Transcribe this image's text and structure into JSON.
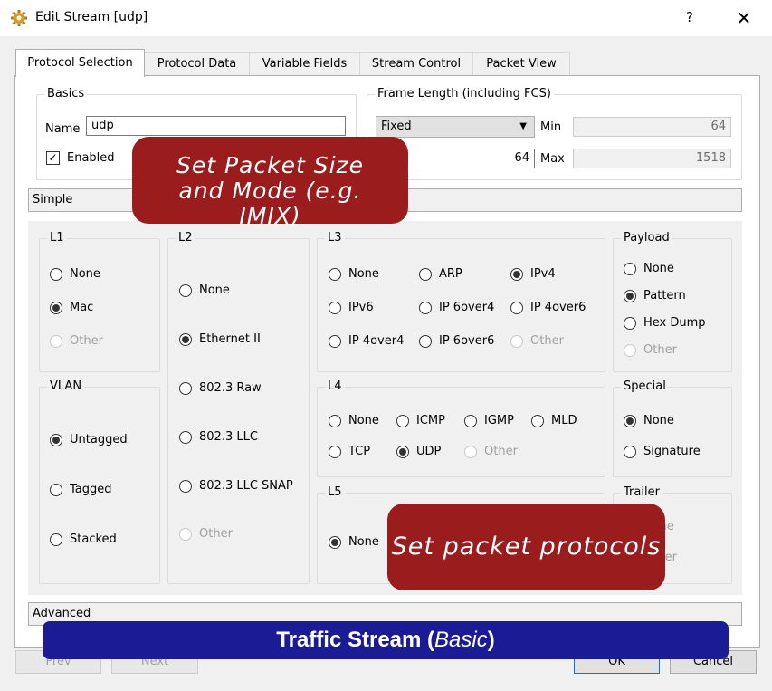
{
  "window": {
    "title": "Edit Stream [udp]",
    "help_label": "?",
    "close_label": "✕",
    "icon": "gear-icon"
  },
  "tabs": [
    {
      "label": "Protocol Selection",
      "active": true
    },
    {
      "label": "Protocol Data",
      "active": false
    },
    {
      "label": "Variable Fields",
      "active": false
    },
    {
      "label": "Stream Control",
      "active": false
    },
    {
      "label": "Packet View",
      "active": false
    }
  ],
  "basics": {
    "title": "Basics",
    "name_label": "Name",
    "name_value": "udp",
    "enabled_label": "Enabled",
    "enabled_checked": true
  },
  "frame_length": {
    "title": "Frame Length (including FCS)",
    "mode": "Fixed",
    "fixed_value": "64",
    "min_label": "Min",
    "min_value": "64",
    "max_label": "Max",
    "max_value": "1518"
  },
  "simple_header": "Simple",
  "advanced_header": "Advanced",
  "groups": {
    "l1": {
      "title": "L1",
      "options": [
        {
          "label": "None",
          "checked": false,
          "disabled": false
        },
        {
          "label": "Mac",
          "checked": true,
          "disabled": false
        },
        {
          "label": "Other",
          "checked": false,
          "disabled": true
        }
      ]
    },
    "vlan": {
      "title": "VLAN",
      "options": [
        {
          "label": "Untagged",
          "checked": true,
          "disabled": false
        },
        {
          "label": "Tagged",
          "checked": false,
          "disabled": false
        },
        {
          "label": "Stacked",
          "checked": false,
          "disabled": false
        }
      ]
    },
    "l2": {
      "title": "L2",
      "options": [
        {
          "label": "None",
          "checked": false,
          "disabled": false
        },
        {
          "label": "Ethernet II",
          "checked": true,
          "disabled": false
        },
        {
          "label": "802.3 Raw",
          "checked": false,
          "disabled": false
        },
        {
          "label": "802.3 LLC",
          "checked": false,
          "disabled": false
        },
        {
          "label": "802.3 LLC SNAP",
          "checked": false,
          "disabled": false
        },
        {
          "label": "Other",
          "checked": false,
          "disabled": true
        }
      ]
    },
    "l3": {
      "title": "L3",
      "options": [
        {
          "label": "None",
          "checked": false,
          "disabled": false
        },
        {
          "label": "ARP",
          "checked": false,
          "disabled": false
        },
        {
          "label": "IPv4",
          "checked": true,
          "disabled": false
        },
        {
          "label": "IPv6",
          "checked": false,
          "disabled": false
        },
        {
          "label": "IP 6over4",
          "checked": false,
          "disabled": false
        },
        {
          "label": "IP 4over6",
          "checked": false,
          "disabled": false
        },
        {
          "label": "IP 4over4",
          "checked": false,
          "disabled": false
        },
        {
          "label": "IP 6over6",
          "checked": false,
          "disabled": false
        },
        {
          "label": "Other",
          "checked": false,
          "disabled": true
        }
      ]
    },
    "l4": {
      "title": "L4",
      "options": [
        {
          "label": "None",
          "checked": false,
          "disabled": false
        },
        {
          "label": "ICMP",
          "checked": false,
          "disabled": false
        },
        {
          "label": "IGMP",
          "checked": false,
          "disabled": false
        },
        {
          "label": "MLD",
          "checked": false,
          "disabled": false
        },
        {
          "label": "TCP",
          "checked": false,
          "disabled": false
        },
        {
          "label": "UDP",
          "checked": true,
          "disabled": false
        },
        {
          "label": "Other",
          "checked": false,
          "disabled": true
        }
      ]
    },
    "l5": {
      "title": "L5",
      "options": [
        {
          "label": "None",
          "checked": true,
          "disabled": false
        }
      ]
    },
    "payload": {
      "title": "Payload",
      "options": [
        {
          "label": "None",
          "checked": false,
          "disabled": false
        },
        {
          "label": "Pattern",
          "checked": true,
          "disabled": false
        },
        {
          "label": "Hex Dump",
          "checked": false,
          "disabled": false
        },
        {
          "label": "Other",
          "checked": false,
          "disabled": true
        }
      ]
    },
    "special": {
      "title": "Special",
      "options": [
        {
          "label": "None",
          "checked": true,
          "disabled": false
        },
        {
          "label": "Signature",
          "checked": false,
          "disabled": false
        }
      ]
    },
    "trailer": {
      "title": "Trailer",
      "options": [
        {
          "label": "None",
          "checked": true,
          "disabled": true
        },
        {
          "label": "Other",
          "checked": false,
          "disabled": true
        }
      ]
    }
  },
  "buttons": {
    "prev": "Prev",
    "next": "Next",
    "ok": "OK",
    "cancel": "Cancel"
  },
  "annotations": {
    "packet_size": "Set Packet Size and Mode (e.g. IMIX)",
    "protocols": "Set packet protocols",
    "banner_main": "Traffic Stream (",
    "banner_italic": "Basic",
    "banner_end": ")"
  },
  "colors": {
    "callout": "#9b1c1c",
    "banner": "#1b1b96"
  }
}
